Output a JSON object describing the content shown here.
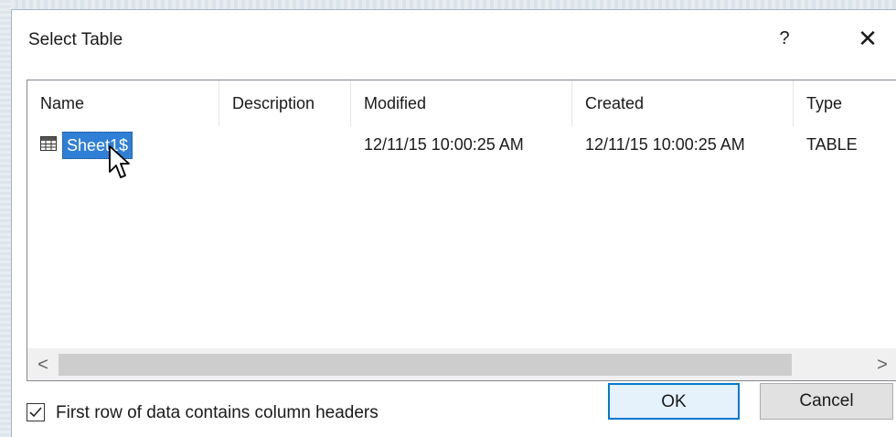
{
  "dialog": {
    "title": "Select Table",
    "help_label": "?",
    "close_label": "✕"
  },
  "table": {
    "columns": [
      "Name",
      "Description",
      "Modified",
      "Created",
      "Type"
    ],
    "rows": [
      {
        "name": "Sheet1$",
        "description": "",
        "modified": "12/11/15 10:00:25 AM",
        "created": "12/11/15 10:00:25 AM",
        "type": "TABLE",
        "icon": "table-icon"
      }
    ]
  },
  "scrollbar": {
    "left_arrow": "<",
    "right_arrow": ">"
  },
  "options": {
    "first_row_headers_label": "First row of data contains column headers",
    "first_row_headers_checked": true
  },
  "buttons": {
    "ok": "OK",
    "cancel": "Cancel"
  },
  "colors": {
    "selection": "#2f7fd6",
    "ok_border": "#0078d7"
  }
}
